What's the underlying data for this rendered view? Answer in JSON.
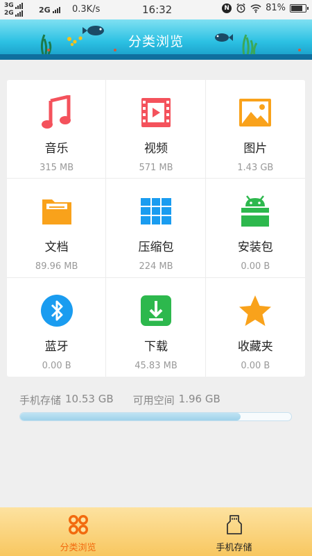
{
  "status_bar": {
    "net_top": "3G",
    "net_bottom": "2G",
    "net_secondary": "2G",
    "speed": "0.3K/s",
    "time": "16:32",
    "nfc": "N",
    "battery": "81%",
    "battery_level": 0.81
  },
  "header": {
    "title": "分类浏览"
  },
  "categories": [
    {
      "label": "音乐",
      "size": "315 MB",
      "icon": "music-note-icon",
      "color": "#f4525c"
    },
    {
      "label": "视频",
      "size": "571 MB",
      "icon": "video-icon",
      "color": "#f4525c"
    },
    {
      "label": "图片",
      "size": "1.43 GB",
      "icon": "image-icon",
      "color": "#f9a21b"
    },
    {
      "label": "文档",
      "size": "89.96 MB",
      "icon": "folder-icon",
      "color": "#f9a21b"
    },
    {
      "label": "压缩包",
      "size": "224 MB",
      "icon": "archive-icon",
      "color": "#1a9cf0"
    },
    {
      "label": "安装包",
      "size": "0.00 B",
      "icon": "android-package-icon",
      "color": "#2db84d"
    },
    {
      "label": "蓝牙",
      "size": "0.00 B",
      "icon": "bluetooth-icon",
      "color": "#1a9cf0"
    },
    {
      "label": "下载",
      "size": "45.83 MB",
      "icon": "download-icon",
      "color": "#2db84d"
    },
    {
      "label": "收藏夹",
      "size": "0.00 B",
      "icon": "star-icon",
      "color": "#f9a21b"
    }
  ],
  "storage": {
    "label": "手机存储",
    "total": "10.53 GB",
    "available_label": "可用空间",
    "available": "1.96 GB",
    "used_fraction": 0.814
  },
  "bottom_nav": [
    {
      "label": "分类浏览",
      "icon": "category-grid-icon",
      "active": true
    },
    {
      "label": "手机存储",
      "icon": "phone-storage-icon",
      "active": false
    }
  ],
  "colors": {
    "accent": "#f26a0e",
    "header": "#2cc1e3"
  }
}
